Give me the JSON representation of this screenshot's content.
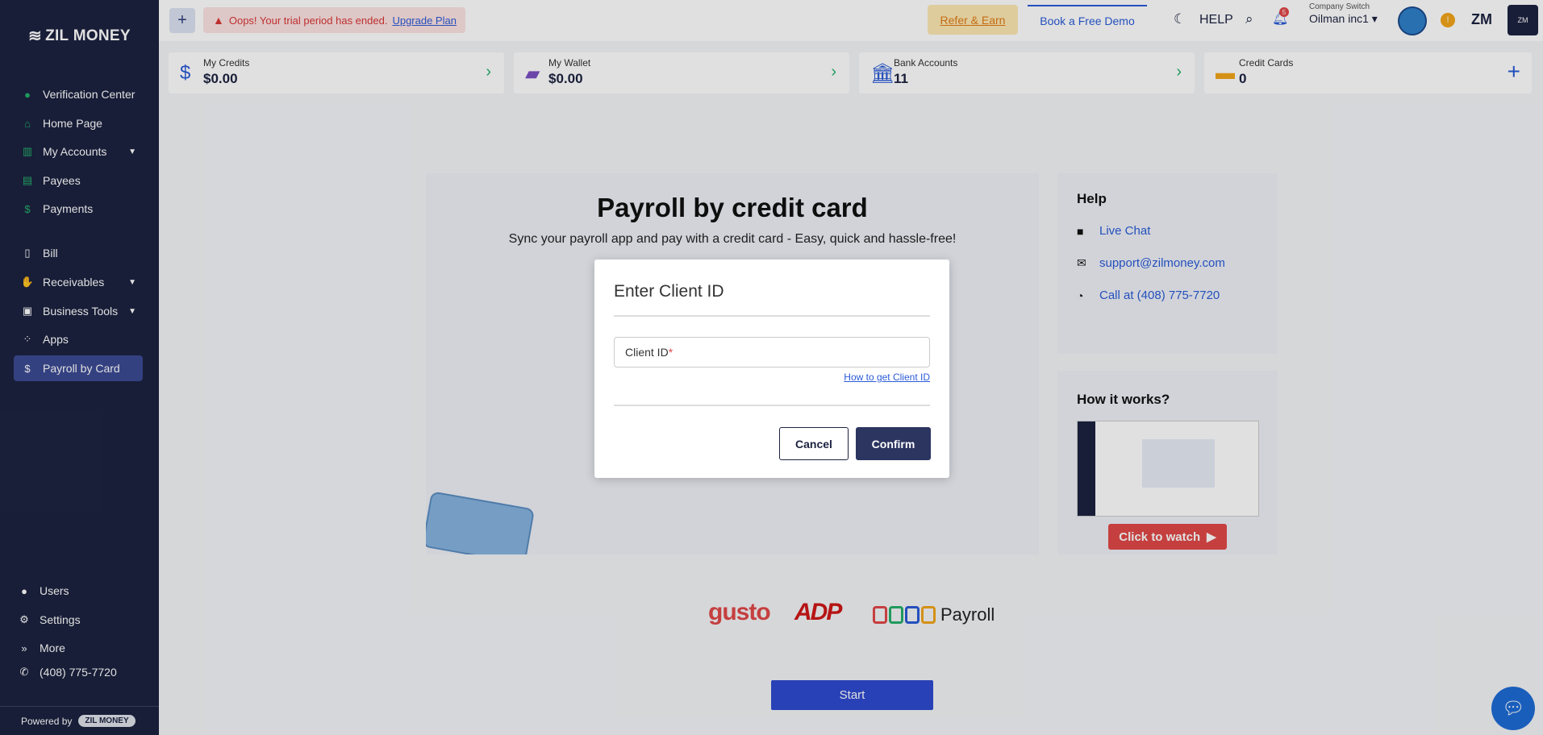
{
  "brand": {
    "logo_text": "ZIL MONEY",
    "powered_label": "Powered by",
    "powered_pill": "ZIL MONEY"
  },
  "sidebar": {
    "items": [
      {
        "label": "Verification Center",
        "icon": "check-circle-icon"
      },
      {
        "label": "Home Page",
        "icon": "home-icon"
      },
      {
        "label": "My Accounts",
        "icon": "bank-icon"
      },
      {
        "label": "Payees",
        "icon": "contact-book-icon"
      },
      {
        "label": "Payments",
        "icon": "dollar-icon"
      },
      {
        "label": "Bill",
        "icon": "document-icon"
      },
      {
        "label": "Receivables",
        "icon": "hand-coins-icon"
      },
      {
        "label": "Business Tools",
        "icon": "toolbox-icon"
      },
      {
        "label": "Apps",
        "icon": "grid-icon"
      },
      {
        "label": "Payroll by Card",
        "icon": "dollar-icon"
      }
    ],
    "bottom_items": [
      {
        "label": "Users",
        "icon": "user-icon"
      },
      {
        "label": "Settings",
        "icon": "gear-icon"
      },
      {
        "label": "More",
        "icon": "double-chevron-icon"
      },
      {
        "label": "(408) 775-7720",
        "icon": "phone-icon"
      }
    ]
  },
  "topbar": {
    "trial_text": "Oops! Your trial period has ended.",
    "upgrade_link": "Upgrade Plan",
    "refer_label": "Refer & Earn",
    "demo_label": "Book a Free Demo",
    "help_label": "HELP",
    "notification_count": "5",
    "company_switch_label": "Company Switch",
    "company_name": "Oilman inc1",
    "user_initials": "ZM"
  },
  "cards": [
    {
      "label": "My Credits",
      "value": "$0.00"
    },
    {
      "label": "My Wallet",
      "value": "$0.00"
    },
    {
      "label": "Bank Accounts",
      "value": "11"
    },
    {
      "label": "Credit Cards",
      "value": "0"
    }
  ],
  "main": {
    "title": "Payroll by credit card",
    "subtitle": "Sync your payroll app and pay with a credit card - Easy, quick and hassle-free!",
    "start_label": "Start"
  },
  "help_panel": {
    "title": "Help",
    "live_chat": "Live Chat",
    "email": "support@zilmoney.com",
    "call": "Call at (408) 775-7720"
  },
  "how_panel": {
    "title": "How it works?",
    "watch_label": "Click to watch"
  },
  "partners": {
    "gusto": "gusto",
    "adp": "ADP",
    "zoho_payroll": "Payroll",
    "zoho_small": "ZOHO"
  },
  "modal": {
    "title": "Enter Client ID",
    "field_label": "Client ID",
    "required_mark": "*",
    "how_link": "How to get Client ID",
    "cancel_label": "Cancel",
    "confirm_label": "Confirm"
  }
}
